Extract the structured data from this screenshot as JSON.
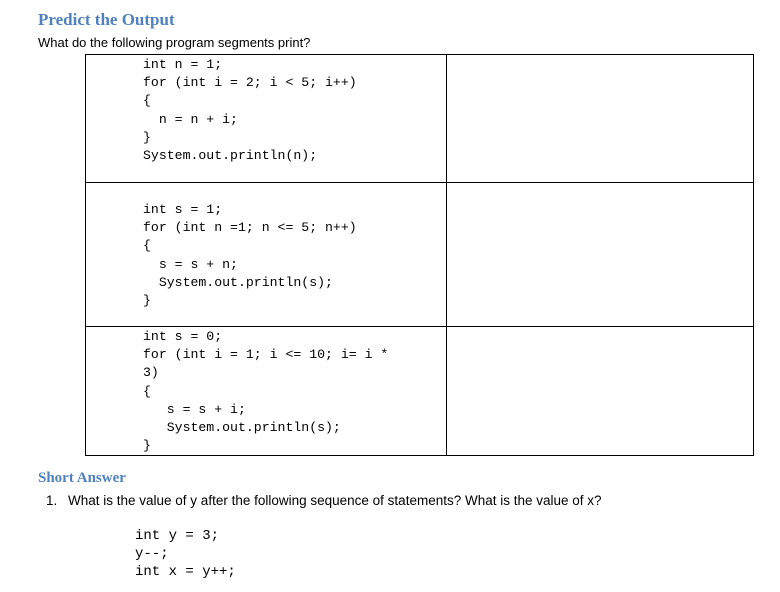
{
  "sections": {
    "predict": {
      "heading": "Predict the Output",
      "intro": "What do the following program segments print?",
      "rows": [
        {
          "code": "int n = 1;\nfor (int i = 2; i < 5; i++)\n{\n  n = n + i;\n}\nSystem.out.println(n);",
          "answer": ""
        },
        {
          "code": "int s = 1;\nfor (int n =1; n <= 5; n++)\n{\n  s = s + n;\n  System.out.println(s);\n}",
          "answer": ""
        },
        {
          "code": "int s = 0;\nfor (int i = 1; i <= 10; i= i *\n3)\n{\n   s = s + i;\n   System.out.println(s);\n}",
          "answer": ""
        }
      ]
    },
    "short_answer": {
      "heading": "Short Answer",
      "questions": [
        {
          "number": "1.",
          "text": "What is the value of y after the following sequence of statements? What is the value of x?",
          "code": "int y = 3;\ny--;\nint x = y++;"
        }
      ]
    }
  }
}
